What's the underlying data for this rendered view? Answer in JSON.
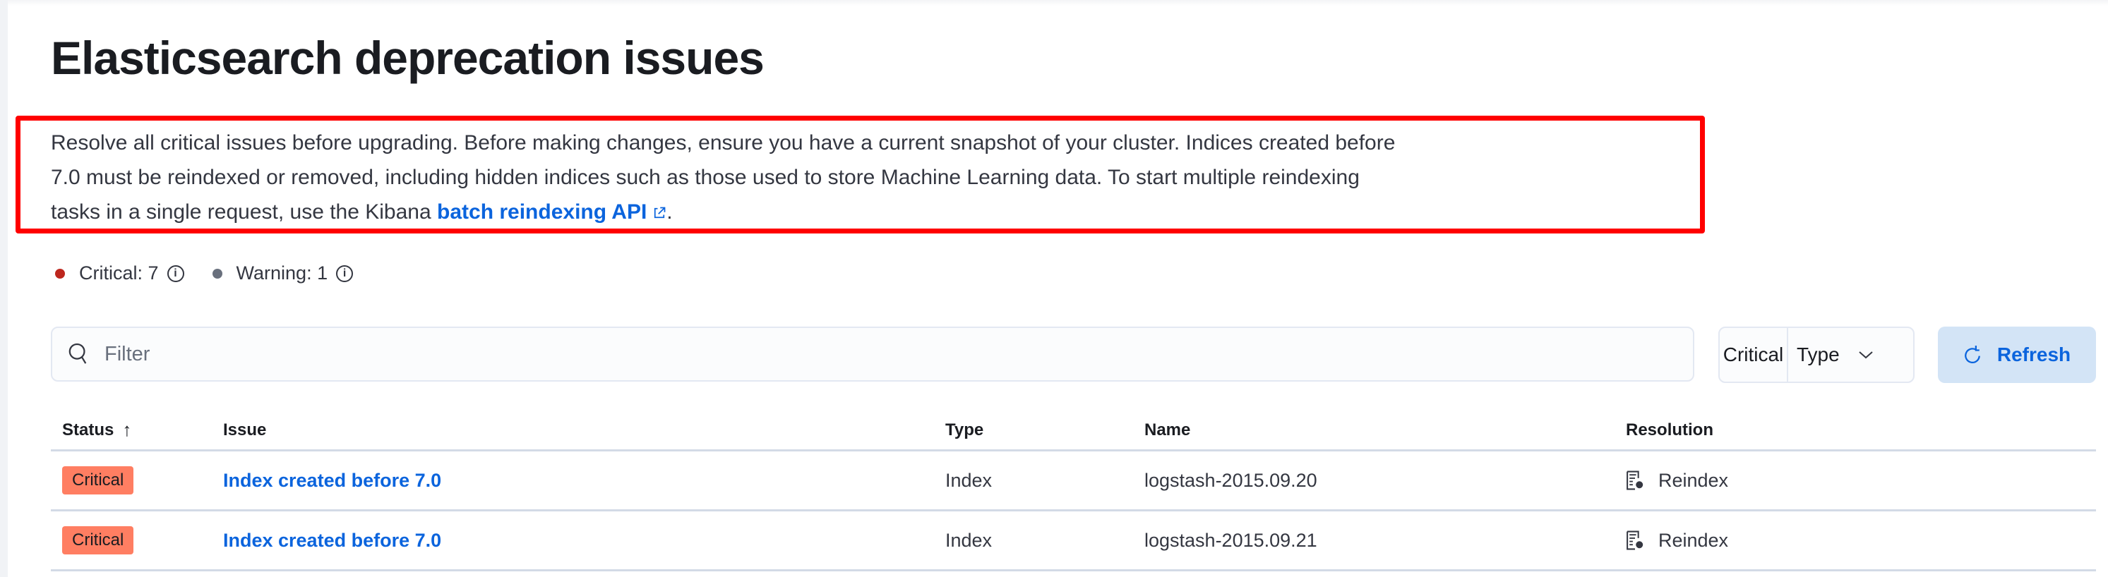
{
  "title": "Elasticsearch deprecation issues",
  "description": {
    "line1": "Resolve all critical issues before upgrading. Before making changes, ensure you have a current snapshot of your cluster. Indices created before",
    "line2": "7.0 must be reindexed or removed, including hidden indices such as those used to store Machine Learning data. To start multiple reindexing",
    "line3_prefix": "tasks in a single request, use the Kibana ",
    "link": "batch reindexing API",
    "line3_suffix": "."
  },
  "stats": {
    "critical": "Critical: 7",
    "warning": "Warning: 1",
    "critical_color": "#bd271e",
    "warning_color": "#69707d"
  },
  "filter": {
    "placeholder": "Filter"
  },
  "filters": {
    "critical": "Critical",
    "type": "Type"
  },
  "refresh": "Refresh",
  "table": {
    "headers": {
      "status": "Status",
      "issue": "Issue",
      "type": "Type",
      "name": "Name",
      "resolution": "Resolution"
    },
    "rows": [
      {
        "status": "Critical",
        "issue": "Index created before 7.0",
        "type": "Index",
        "name": "logstash-2015.09.20",
        "resolution": "Reindex"
      },
      {
        "status": "Critical",
        "issue": "Index created before 7.0",
        "type": "Index",
        "name": "logstash-2015.09.21",
        "resolution": "Reindex"
      }
    ]
  }
}
